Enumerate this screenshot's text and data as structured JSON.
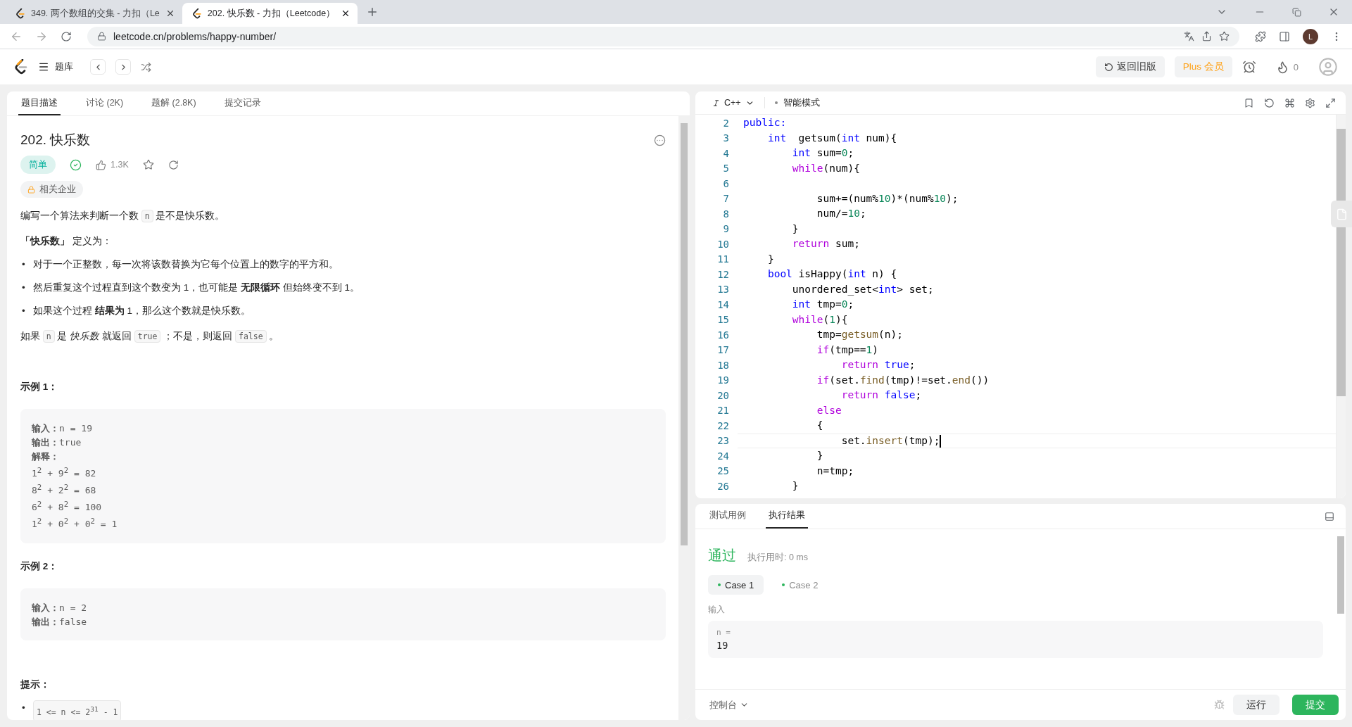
{
  "browser": {
    "tabs": [
      {
        "title": "349. 两个数组的交集 - 力扣（Le",
        "selected": false
      },
      {
        "title": "202. 快乐数 - 力扣（Leetcode）",
        "selected": true
      }
    ],
    "url": "leetcode.cn/problems/happy-number/",
    "profile_initial": "L"
  },
  "header": {
    "nav_label": "题库",
    "legacy_button": "返回旧版",
    "plus_button": "Plus 会员",
    "streak_count": "0"
  },
  "problem": {
    "tabs": [
      {
        "label": "题目描述",
        "selected": true
      },
      {
        "label": "讨论 (2K)",
        "selected": false
      },
      {
        "label": "题解 (2.8K)",
        "selected": false
      },
      {
        "label": "提交记录",
        "selected": false
      }
    ],
    "title": "202. 快乐数",
    "difficulty": "简单",
    "likes": "1.3K",
    "companies": "相关企业",
    "content": [
      {
        "kind": "paragraph",
        "parts": [
          {
            "kind": "text",
            "text": "编写一个算法来判断一个数 "
          },
          {
            "kind": "code",
            "text": "n"
          },
          {
            "kind": "text",
            "text": " 是不是快乐数。"
          }
        ]
      },
      {
        "kind": "paragraph",
        "parts": [
          {
            "kind": "text",
            "text": "**「快乐数」** 定义为："
          }
        ]
      },
      {
        "kind": "bullet",
        "marker": "•",
        "parts": [
          {
            "kind": "text",
            "text": "对于一个正整数，每一次将该数替换为它每个位置上的数字的平方和。"
          }
        ]
      },
      {
        "kind": "bullet",
        "marker": "•",
        "parts": [
          {
            "kind": "text",
            "text": "然后重复这个过程直到这个数变为 1，也可能是 **无限循环** 但始终变不到 1。"
          }
        ]
      },
      {
        "kind": "bullet",
        "marker": "•",
        "parts": [
          {
            "kind": "text",
            "text": "如果这个过程 **结果为** 1，那么这个数就是快乐数。"
          }
        ]
      },
      {
        "kind": "paragraph",
        "parts": [
          {
            "kind": "text",
            "text": "如果 "
          },
          {
            "kind": "code",
            "text": "n"
          },
          {
            "kind": "text",
            "text": " 是 *快乐数* 就返回 "
          },
          {
            "kind": "code",
            "text": "true"
          },
          {
            "kind": "text",
            "text": " ；不是，则返回 "
          },
          {
            "kind": "code",
            "text": "false"
          },
          {
            "kind": "text",
            "text": " 。"
          }
        ]
      }
    ],
    "examples": [
      {
        "title": "示例 1：",
        "lines": [
          "**输入：**n = 19",
          "**输出：**true",
          "**解释：**",
          "1$^{2}$ + 9$^{2}$ = 82",
          "8$^{2}$ + 2$^{2}$ = 68",
          "6$^{2}$ + 8$^{2}$ = 100",
          "1$^{2}$ + 0$^{2}$ + 0$^{2}$ = 1"
        ]
      },
      {
        "title": "示例 2：",
        "lines": [
          "**输入：**n = 2",
          "**输出：**false"
        ]
      }
    ],
    "hints_title": "提示：",
    "hints": [
      {
        "marker": "•",
        "text": "1 <= n <= 2$^{31}$ - 1"
      }
    ]
  },
  "editor": {
    "language": "C++",
    "mode": "智能模式",
    "lines": [
      {
        "number": "2",
        "current": false,
        "segments": [
          {
            "kind": "keyword",
            "text": "public:"
          }
        ]
      },
      {
        "number": "3",
        "current": false,
        "segments": [
          {
            "kind": "keyword",
            "text": "    int"
          },
          {
            "kind": "plain",
            "text": "  getsum("
          },
          {
            "kind": "keyword",
            "text": "int"
          },
          {
            "kind": "plain",
            "text": " num){"
          }
        ]
      },
      {
        "number": "4",
        "current": false,
        "segments": [
          {
            "kind": "keyword",
            "text": "        int"
          },
          {
            "kind": "plain",
            "text": " sum="
          },
          {
            "kind": "number",
            "text": "0"
          },
          {
            "kind": "plain",
            "text": ";"
          }
        ]
      },
      {
        "number": "5",
        "current": false,
        "segments": [
          {
            "kind": "control",
            "text": "        while"
          },
          {
            "kind": "plain",
            "text": "(num){"
          }
        ]
      },
      {
        "number": "6",
        "current": false
      },
      {
        "number": "7",
        "current": false,
        "segments": [
          {
            "kind": "plain",
            "text": "            sum+=(num%"
          },
          {
            "kind": "number",
            "text": "10"
          },
          {
            "kind": "plain",
            "text": ")*(num%"
          },
          {
            "kind": "number",
            "text": "10"
          },
          {
            "kind": "plain",
            "text": ");"
          }
        ]
      },
      {
        "number": "8",
        "current": false,
        "segments": [
          {
            "kind": "plain",
            "text": "            num/="
          },
          {
            "kind": "number",
            "text": "10"
          },
          {
            "kind": "plain",
            "text": ";"
          }
        ]
      },
      {
        "number": "9",
        "current": false,
        "segments": [
          {
            "kind": "plain",
            "text": "        }"
          }
        ]
      },
      {
        "number": "10",
        "current": false,
        "segments": [
          {
            "kind": "control",
            "text": "        return"
          },
          {
            "kind": "plain",
            "text": " sum;"
          }
        ]
      },
      {
        "number": "11",
        "current": false,
        "segments": [
          {
            "kind": "plain",
            "text": "    }"
          }
        ]
      },
      {
        "number": "12",
        "current": false,
        "segments": [
          {
            "kind": "keyword",
            "text": "    bool"
          },
          {
            "kind": "plain",
            "text": " isHappy("
          },
          {
            "kind": "keyword",
            "text": "int"
          },
          {
            "kind": "plain",
            "text": " n) {"
          }
        ]
      },
      {
        "number": "13",
        "current": false,
        "segments": [
          {
            "kind": "plain",
            "text": "        unordered_set<"
          },
          {
            "kind": "keyword",
            "text": "int"
          },
          {
            "kind": "plain",
            "text": "> set;"
          }
        ]
      },
      {
        "number": "14",
        "current": false,
        "segments": [
          {
            "kind": "keyword",
            "text": "        int"
          },
          {
            "kind": "plain",
            "text": " tmp="
          },
          {
            "kind": "number",
            "text": "0"
          },
          {
            "kind": "plain",
            "text": ";"
          }
        ]
      },
      {
        "number": "15",
        "current": false,
        "segments": [
          {
            "kind": "control",
            "text": "        while"
          },
          {
            "kind": "plain",
            "text": "("
          },
          {
            "kind": "number",
            "text": "1"
          },
          {
            "kind": "plain",
            "text": "){"
          }
        ]
      },
      {
        "number": "16",
        "current": false,
        "segments": [
          {
            "kind": "plain",
            "text": "            tmp="
          },
          {
            "kind": "function",
            "text": "getsum"
          },
          {
            "kind": "plain",
            "text": "(n);"
          }
        ]
      },
      {
        "number": "17",
        "current": false,
        "segments": [
          {
            "kind": "control",
            "text": "            if"
          },
          {
            "kind": "plain",
            "text": "(tmp=="
          },
          {
            "kind": "number",
            "text": "1"
          },
          {
            "kind": "plain",
            "text": ")"
          }
        ]
      },
      {
        "number": "18",
        "current": false,
        "segments": [
          {
            "kind": "control",
            "text": "                return"
          },
          {
            "kind": "keyword",
            "text": " true"
          },
          {
            "kind": "plain",
            "text": ";"
          }
        ]
      },
      {
        "number": "19",
        "current": false,
        "segments": [
          {
            "kind": "control",
            "text": "            if"
          },
          {
            "kind": "plain",
            "text": "(set."
          },
          {
            "kind": "function",
            "text": "find"
          },
          {
            "kind": "plain",
            "text": "(tmp)!=set."
          },
          {
            "kind": "function",
            "text": "end"
          },
          {
            "kind": "plain",
            "text": "())"
          }
        ]
      },
      {
        "number": "20",
        "current": false,
        "segments": [
          {
            "kind": "control",
            "text": "                return"
          },
          {
            "kind": "keyword",
            "text": " false"
          },
          {
            "kind": "plain",
            "text": ";"
          }
        ]
      },
      {
        "number": "21",
        "current": false,
        "segments": [
          {
            "kind": "control",
            "text": "            else"
          }
        ]
      },
      {
        "number": "22",
        "current": false,
        "segments": [
          {
            "kind": "plain",
            "text": "            {"
          }
        ]
      },
      {
        "number": "23",
        "current": true,
        "segments": [
          {
            "kind": "plain",
            "text": "                set."
          },
          {
            "kind": "function",
            "text": "insert"
          },
          {
            "kind": "plain",
            "text": "(tmp);"
          }
        ]
      },
      {
        "number": "24",
        "current": false,
        "segments": [
          {
            "kind": "plain",
            "text": "            }"
          }
        ]
      },
      {
        "number": "25",
        "current": false,
        "segments": [
          {
            "kind": "plain",
            "text": "            n=tmp;"
          }
        ]
      },
      {
        "number": "26",
        "current": false,
        "segments": [
          {
            "kind": "plain",
            "text": "        }"
          }
        ]
      }
    ]
  },
  "console": {
    "tabs": [
      {
        "label": "测试用例",
        "selected": false
      },
      {
        "label": "执行结果",
        "selected": true
      }
    ],
    "verdict": "通过",
    "runtime": "执行用时: 0 ms",
    "cases": [
      {
        "label": "Case 1",
        "selected": true
      },
      {
        "label": "Case 2",
        "selected": false
      }
    ],
    "input_label": "输入",
    "input_name": "n =",
    "input_value": "19",
    "console_toggle": "控制台",
    "run_button": "运行",
    "submit_button": "提交"
  }
}
